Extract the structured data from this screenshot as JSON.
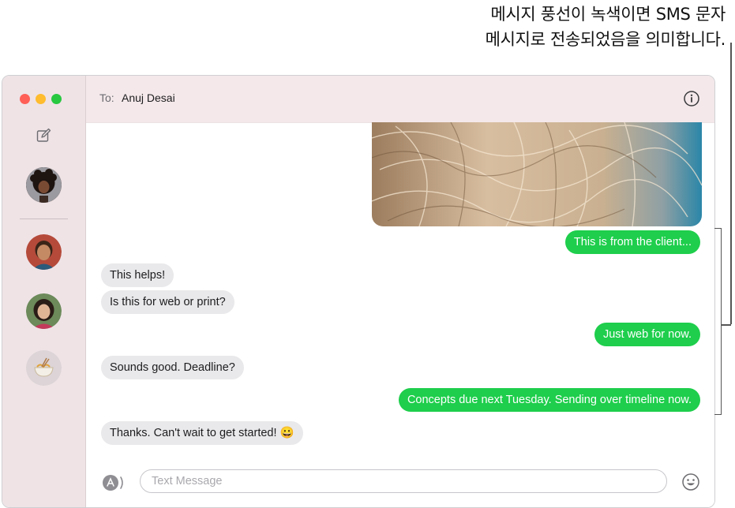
{
  "callout": {
    "line1": "메시지 풍선이 녹색이면 SMS 문자",
    "line2": "메시지로 전송되었음을 의미합니다."
  },
  "header": {
    "to_label": "To:",
    "recipient": "Anuj Desai"
  },
  "messages": [
    {
      "direction": "out",
      "text": "This is from the client..."
    },
    {
      "direction": "in",
      "text": "This helps!"
    },
    {
      "direction": "in",
      "text": "Is this for web or print?"
    },
    {
      "direction": "out",
      "text": "Just web for now."
    },
    {
      "direction": "in",
      "text": "Sounds good. Deadline?"
    },
    {
      "direction": "out",
      "text": "Concepts due next Tuesday. Sending over timeline now."
    },
    {
      "direction": "in",
      "text": "Thanks. Can't wait to get started! 😀"
    }
  ],
  "composer": {
    "placeholder": "Text Message"
  },
  "colors": {
    "sms_bubble": "#1ece4c",
    "received_bubble": "#e9e9eb",
    "sidebar": "#efe3e6",
    "header": "#f4e8ea"
  },
  "icons": [
    "compose-icon",
    "info-icon",
    "app-store-icon",
    "emoji-icon"
  ]
}
